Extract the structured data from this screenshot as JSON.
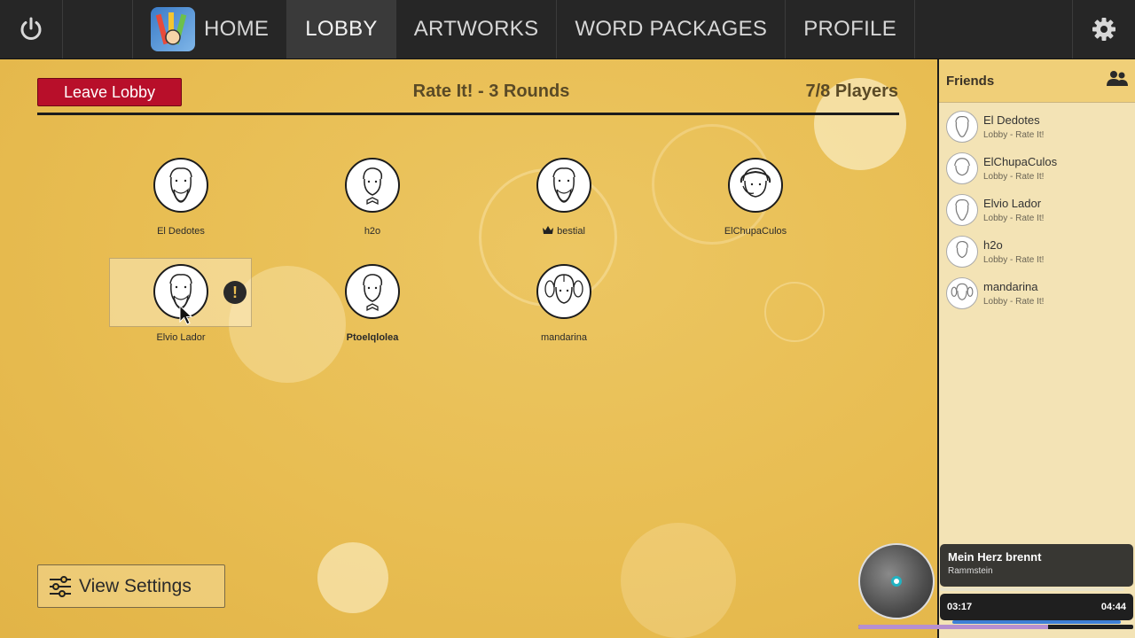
{
  "nav": {
    "items": [
      {
        "label": "HOME"
      },
      {
        "label": "LOBBY"
      },
      {
        "label": "ARTWORKS"
      },
      {
        "label": "WORD PACKAGES"
      },
      {
        "label": "PROFILE"
      }
    ],
    "active": "LOBBY",
    "icons": {
      "left": "power-icon",
      "right": "gear-icon"
    }
  },
  "lobby": {
    "leave_label": "Leave Lobby",
    "mode_title": "Rate It! - 3 Rounds",
    "player_count": "7/8 Players",
    "players": [
      {
        "name": "El Dedotes"
      },
      {
        "name": "h2o"
      },
      {
        "name": "bestial",
        "host": true
      },
      {
        "name": "ElChupaCulos"
      },
      {
        "name": "Elvio Lador",
        "highlighted": true
      },
      {
        "name": "Ptoelqlolea",
        "bold": true
      },
      {
        "name": "mandarina"
      }
    ],
    "view_settings_label": "View Settings"
  },
  "friends": {
    "title": "Friends",
    "list": [
      {
        "name": "El Dedotes",
        "status": "Lobby - Rate It!"
      },
      {
        "name": "ElChupaCulos",
        "status": "Lobby - Rate It!"
      },
      {
        "name": "Elvio Lador",
        "status": "Lobby - Rate It!"
      },
      {
        "name": "h2o",
        "status": "Lobby - Rate It!"
      },
      {
        "name": "mandarina",
        "status": "Lobby - Rate It!"
      }
    ]
  },
  "music": {
    "title": "Mein Herz brennt",
    "artist": "Rammstein",
    "elapsed": "03:17",
    "duration": "04:44",
    "progress": 0.69
  },
  "colors": {
    "accent_red": "#b80f2a",
    "background_gold": "#e8bd52",
    "nav_dark": "#262626"
  }
}
